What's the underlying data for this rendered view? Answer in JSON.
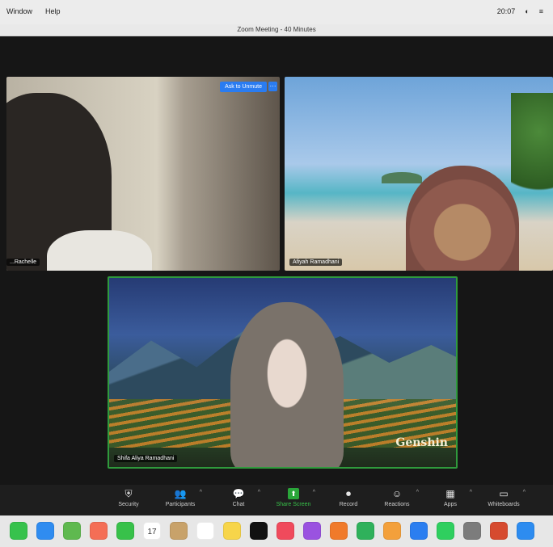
{
  "menubar": {
    "items": [
      "Window",
      "Help"
    ],
    "right": [
      "20:07",
      "◐",
      "≡"
    ]
  },
  "window": {
    "title": "Zoom Meeting - 40 Minutes"
  },
  "tiles": [
    {
      "name": "...Rachelle",
      "button": "Ask to Unmute",
      "more": "···"
    },
    {
      "name": "Afiyah Ramadhani"
    },
    {
      "name": "Shifa Aliya Ramadhani",
      "watermark": "Genshin"
    }
  ],
  "toolbar": [
    {
      "label": "Security",
      "icon": "shield-icon",
      "glyph": "⛨"
    },
    {
      "label": "Participants",
      "icon": "participants-icon",
      "glyph": "👥"
    },
    {
      "label": "Chat",
      "icon": "chat-icon",
      "glyph": "💬"
    },
    {
      "label": "Share Screen",
      "icon": "share-screen-icon",
      "glyph": "⬆"
    },
    {
      "label": "Record",
      "icon": "record-icon",
      "glyph": "⏺"
    },
    {
      "label": "Reactions",
      "icon": "reactions-icon",
      "glyph": "☺"
    },
    {
      "label": "Apps",
      "icon": "apps-icon",
      "glyph": "▦"
    },
    {
      "label": "Whiteboards",
      "icon": "whiteboard-icon",
      "glyph": "▭"
    }
  ],
  "dock": {
    "calendar_day": "17",
    "apps": [
      "messages-icon",
      "mail-icon",
      "maps-icon",
      "photos-icon",
      "facetime-icon",
      "calendar-icon",
      "contacts-icon",
      "reminders-icon",
      "notes-icon",
      "tv-icon",
      "music-icon",
      "podcasts-icon",
      "books-icon",
      "numbers-icon",
      "pages-icon",
      "appstore-icon",
      "whatsapp-icon",
      "settings-icon",
      "powerpoint-icon",
      "zoom-icon"
    ],
    "colors": [
      "#37c24d",
      "#2f8cf0",
      "#5fb94f",
      "#f46e56",
      "#38c14a",
      "#ffffff",
      "#c8a26a",
      "#ffffff",
      "#f7d54a",
      "#111111",
      "#f04a5c",
      "#9a52e0",
      "#f07a2a",
      "#2fb15b",
      "#f3a03b",
      "#2b7ef0",
      "#2fcf5f",
      "#7c7c7c",
      "#d64a2f",
      "#2d8cf0"
    ]
  }
}
